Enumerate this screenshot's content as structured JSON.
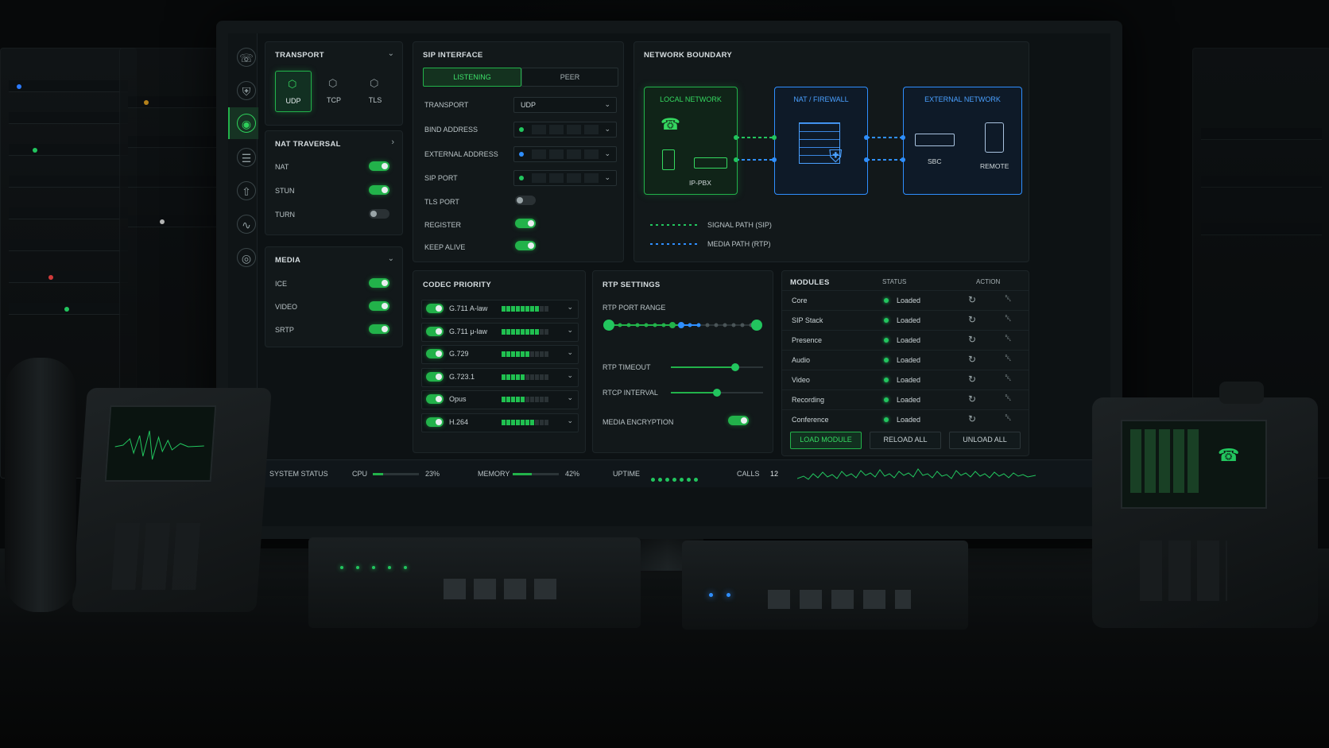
{
  "sidebar": {
    "icons": [
      "phone-settings-icon",
      "shield-icon",
      "network-icon",
      "list-icon",
      "upload-icon",
      "chart-icon",
      "target-icon"
    ],
    "active_index": 2
  },
  "transport": {
    "title": "TRANSPORT",
    "options": [
      {
        "label": "UDP",
        "active": true
      },
      {
        "label": "TCP",
        "active": false
      },
      {
        "label": "TLS",
        "active": false
      }
    ]
  },
  "nat_traversal": {
    "title": "NAT TRAVERSAL",
    "items": [
      {
        "label": "NAT",
        "on": true
      },
      {
        "label": "STUN",
        "on": true
      },
      {
        "label": "TURN",
        "on": false
      }
    ]
  },
  "media": {
    "title": "MEDIA",
    "items": [
      {
        "label": "ICE",
        "on": true
      },
      {
        "label": "VIDEO",
        "on": true
      },
      {
        "label": "SRTP",
        "on": true
      }
    ]
  },
  "sip_interface": {
    "title": "SIP INTERFACE",
    "tabs": [
      "LISTENING",
      "PEER"
    ],
    "transport_label": "TRANSPORT",
    "transport_value": "UDP",
    "bind_address_label": "BIND ADDRESS",
    "external_address_label": "EXTERNAL ADDRESS",
    "sip_port_label": "SIP PORT",
    "tls_port_label": "TLS PORT",
    "tls_port_on": false,
    "register_label": "REGISTER",
    "register_on": true,
    "keep_alive_label": "KEEP ALIVE",
    "keep_alive_on": true
  },
  "network_boundary": {
    "title": "NETWORK BOUNDARY",
    "local": "LOCAL NETWORK",
    "local_device": "IP-PBX",
    "nat": "NAT / FIREWALL",
    "external": "EXTERNAL NETWORK",
    "sbc": "SBC",
    "remote": "REMOTE",
    "legend_signal": "SIGNAL PATH (SIP)",
    "legend_media": "MEDIA PATH (RTP)",
    "colors": {
      "signal": "#22c55e",
      "media": "#2f8fff"
    }
  },
  "codec_priority": {
    "title": "CODEC PRIORITY",
    "codecs": [
      {
        "label": "G.711 A-law",
        "level": 8
      },
      {
        "label": "G.711 μ-law",
        "level": 8
      },
      {
        "label": "G.729",
        "level": 6
      },
      {
        "label": "G.723.1",
        "level": 5
      },
      {
        "label": "Opus",
        "level": 5
      },
      {
        "label": "H.264",
        "level": 7
      }
    ],
    "max_level": 10
  },
  "rtp_settings": {
    "title": "RTP SETTINGS",
    "port_range_label": "RTP PORT RANGE",
    "timeout_label": "RTP TIMEOUT",
    "timeout_level": 0.7,
    "rtcp_label": "RTCP INTERVAL",
    "rtcp_level": 0.5,
    "encryption_label": "MEDIA ENCRYPTION",
    "encryption_on": true
  },
  "modules": {
    "title": "MODULES",
    "status_header": "STATUS",
    "action_header": "ACTION",
    "rows": [
      {
        "name": "Core",
        "status": "Loaded"
      },
      {
        "name": "SIP Stack",
        "status": "Loaded"
      },
      {
        "name": "Presence",
        "status": "Loaded"
      },
      {
        "name": "Audio",
        "status": "Loaded"
      },
      {
        "name": "Video",
        "status": "Loaded"
      },
      {
        "name": "Recording",
        "status": "Loaded"
      },
      {
        "name": "Conference",
        "status": "Loaded"
      }
    ],
    "load_label": "LOAD MODULE",
    "reload_label": "RELOAD ALL",
    "unload_label": "UNLOAD ALL"
  },
  "status_bar": {
    "system_status": "SYSTEM STATUS",
    "cpu_label": "CPU",
    "cpu_value": "23%",
    "cpu_level": 0.23,
    "memory_label": "MEMORY",
    "memory_value": "42%",
    "memory_level": 0.42,
    "uptime_label": "UPTIME",
    "calls_label": "CALLS",
    "calls_value": "12"
  },
  "colors": {
    "accent": "#22b24a",
    "blue": "#2f8fff",
    "bg": "#0d1214"
  }
}
